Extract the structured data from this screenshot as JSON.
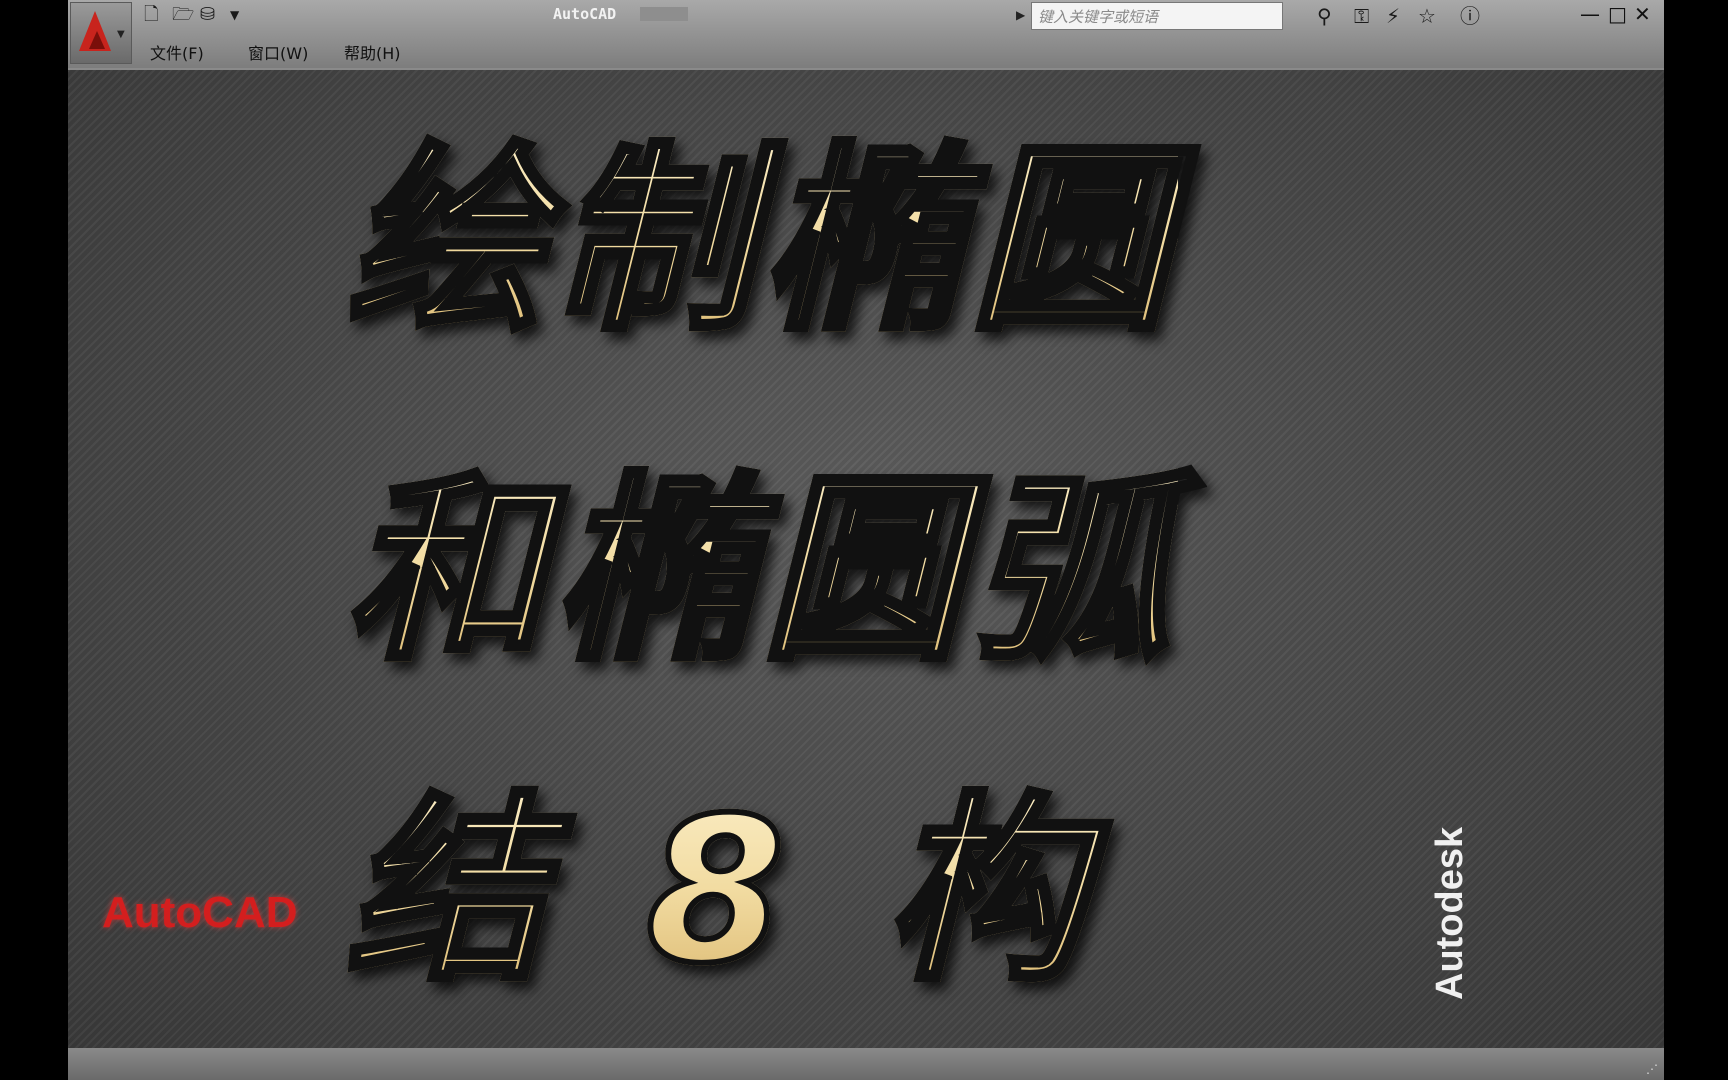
{
  "window": {
    "title": "AutoCAD",
    "search_placeholder": "键入关键字或短语"
  },
  "menu": [
    {
      "label": "文件(F)"
    },
    {
      "label": "窗口(W)"
    },
    {
      "label": "帮助(H)"
    }
  ],
  "quick_access_icons": [
    "new-file-icon",
    "open-folder-icon",
    "save-icon",
    "dropdown-icon"
  ],
  "toolbar_icons": [
    "binoculars-icon",
    "key-icon",
    "satellite-icon",
    "star-icon",
    "help-icon"
  ],
  "window_controls": {
    "minimize": "—",
    "maximize": "□",
    "close": "✕"
  },
  "overlay": {
    "line1": "绘制椭圆",
    "line2": "和椭圆弧",
    "line3": "结8构"
  },
  "branding": {
    "autocad": "AutoCAD",
    "autodesk": "Autodesk"
  },
  "colors": {
    "accent_red": "#d41e1e",
    "text_gold": "#f2dca2"
  }
}
